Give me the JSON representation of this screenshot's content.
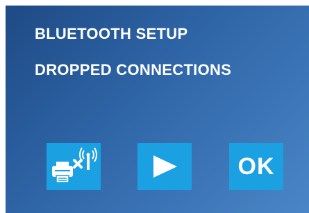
{
  "screen": {
    "line1": "BLUETOOTH  SETUP",
    "line2": "DROPPED CONNECTIONS"
  },
  "buttons": {
    "printer_icon": "printer-bluetooth-disconnected-icon",
    "play_icon": "play-icon",
    "ok_label": "OK"
  },
  "colors": {
    "button_bg": "#1ba1e2",
    "screen_gradient_start": "#1e4a85",
    "screen_gradient_end": "#4a86c7",
    "text": "#ffffff"
  }
}
